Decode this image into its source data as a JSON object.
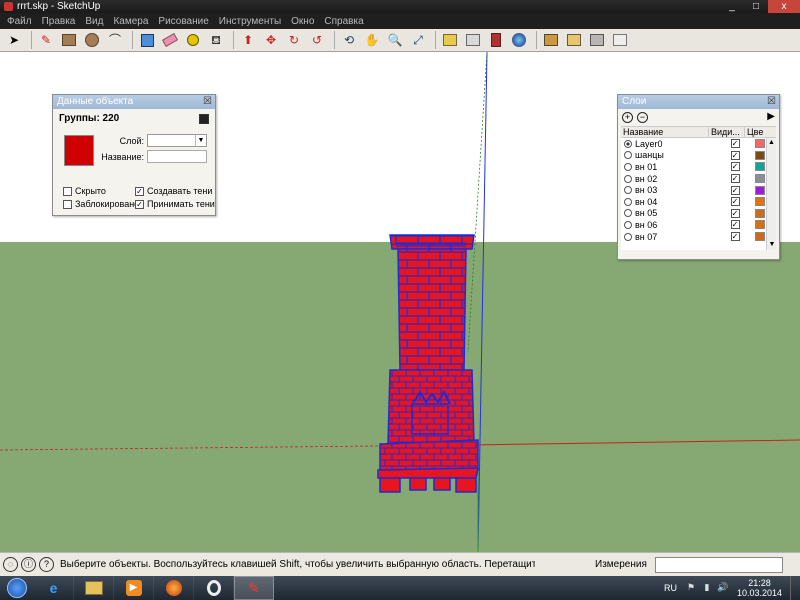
{
  "window": {
    "title": "rrrt.skp - SketchUp",
    "buttons": [
      "_",
      "□",
      "x"
    ]
  },
  "menu": [
    "Файл",
    "Правка",
    "Вид",
    "Камера",
    "Рисование",
    "Инструменты",
    "Окно",
    "Справка"
  ],
  "toolbar": {
    "icons": [
      "select-icon",
      "pencil-icon",
      "rectangle-icon",
      "circle-icon",
      "arc-icon",
      "make-component-icon",
      "eraser-icon",
      "tape-measure-icon",
      "paint-bucket-icon",
      "push-pull-icon",
      "move-icon",
      "rotate-icon",
      "offset-icon",
      "orbit-icon",
      "pan-icon",
      "zoom-icon",
      "zoom-extents-icon",
      "3d-warehouse-icon",
      "share-model-icon",
      "components-icon",
      "google-earth-icon",
      "photo-textures-icon",
      "preview-icon",
      "extension-warehouse-icon",
      "layout-icon"
    ]
  },
  "entity_info": {
    "title": "Данные объекта",
    "header": "Группы: 220",
    "color": "#d00000",
    "layer_label": "Слой:",
    "layer_value": "",
    "name_label": "Название:",
    "name_value": "",
    "hidden_label": "Скрыто",
    "hidden_checked": false,
    "locked_label": "Заблокировано",
    "locked_checked": false,
    "cast_shadows_label": "Создавать тени",
    "cast_shadows_checked": true,
    "receive_shadows_label": "Принимать тени",
    "receive_shadows_checked": true
  },
  "layers_panel": {
    "title": "Слои",
    "col_name": "Название",
    "col_visible": "Види...",
    "col_color": "Цве",
    "layers": [
      {
        "name": "Layer0",
        "active": true,
        "visible": true,
        "color": "#f06a6a"
      },
      {
        "name": "шанцы",
        "active": false,
        "visible": true,
        "color": "#7a4a12"
      },
      {
        "name": "вн 01",
        "active": false,
        "visible": true,
        "color": "#14a29a"
      },
      {
        "name": "вн 02",
        "active": false,
        "visible": true,
        "color": "#8a8f96"
      },
      {
        "name": "вн 03",
        "active": false,
        "visible": true,
        "color": "#a11ad6"
      },
      {
        "name": "вн 04",
        "active": false,
        "visible": true,
        "color": "#e2730f"
      },
      {
        "name": "вн 05",
        "active": false,
        "visible": true,
        "color": "#cf6a1e"
      },
      {
        "name": "вн 06",
        "active": false,
        "visible": true,
        "color": "#d9700e"
      },
      {
        "name": "вн 07",
        "active": false,
        "visible": true,
        "color": "#d06818"
      }
    ]
  },
  "statusbar": {
    "text": "Выберите объекты. Воспользуйтесь клавишей Shift, чтобы увеличить выбранную область. Перетащите мышь, ч",
    "measure_label": "Измерения",
    "measure_value": ""
  },
  "taskbar": {
    "apps": [
      "ie-icon",
      "explorer-icon",
      "media-player-icon",
      "firefox-icon",
      "opera-icon",
      "sketchup-icon"
    ],
    "language": "RU",
    "time": "21:28",
    "date": "10.03.2014"
  },
  "scene": {
    "sky_color": "#ffffff",
    "ground_color": "#86a873",
    "brick_color": "#e8141e",
    "selection_color": "#1c2bd8"
  }
}
